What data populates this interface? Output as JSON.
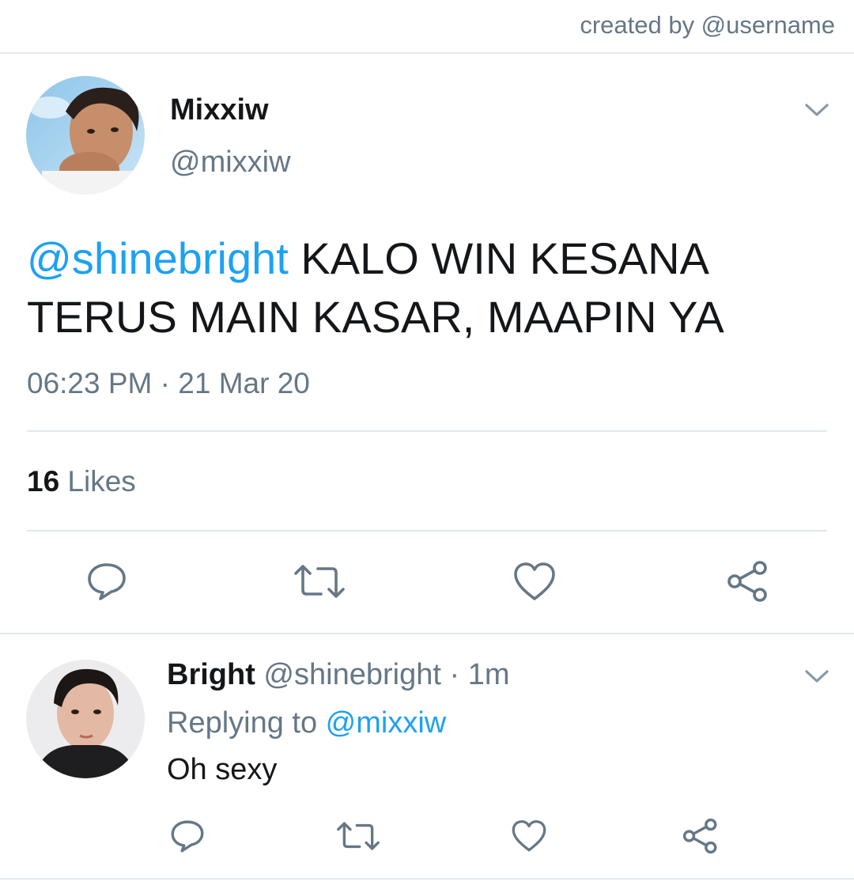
{
  "credit": "created by @username",
  "tweet": {
    "author_name": "Mixxiw",
    "author_handle": "@mixxiw",
    "mention": "@shinebright",
    "text": " KALO WIN KESANA TERUS MAIN KASAR, MAAPIN YA",
    "time": "06:23 PM",
    "separator": " · ",
    "date": "21 Mar 20",
    "likes_count": "16",
    "likes_label": " Likes"
  },
  "reply": {
    "author_name": "Bright",
    "author_handle": " @shinebright",
    "age": " · 1m",
    "replying_prefix": "Replying to ",
    "replying_handle": "@mixxiw",
    "text": "Oh sexy"
  },
  "icons": {
    "reply": "speech-bubble-icon",
    "retweet": "retweet-icon",
    "like": "heart-icon",
    "share": "share-icon",
    "menu": "chevron-down-icon"
  },
  "colors": {
    "link": "#1da1f2",
    "secondary": "#657786",
    "divider": "#e1e8ed",
    "text": "#14171a"
  }
}
